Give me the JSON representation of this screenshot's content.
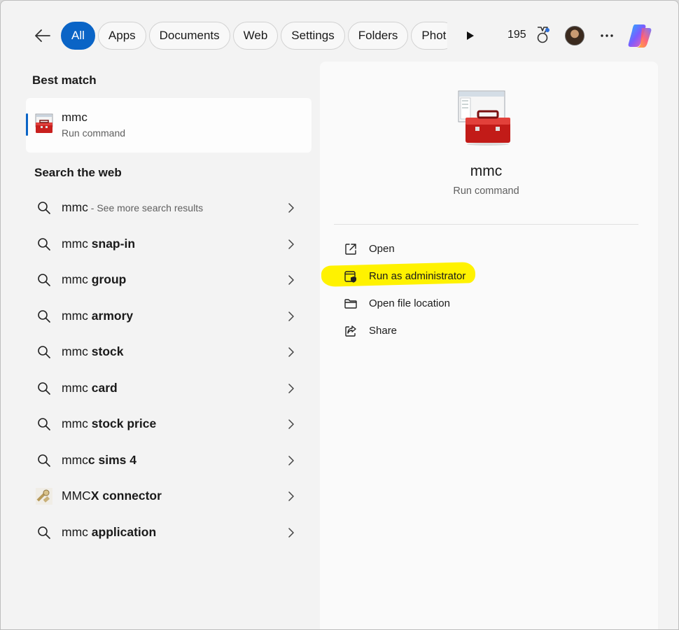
{
  "toolbar": {
    "filters": [
      "All",
      "Apps",
      "Documents",
      "Web",
      "Settings",
      "Folders",
      "Phot"
    ],
    "active_filter": "All",
    "points": "195"
  },
  "best_match": {
    "heading": "Best match",
    "name": "mmc",
    "type": "Run command"
  },
  "web_search": {
    "heading": "Search the web",
    "items": [
      {
        "prefix": "mmc",
        "bold": "",
        "more": " - See more search results",
        "icon": "search-icon"
      },
      {
        "prefix": "mmc ",
        "bold": "snap-in",
        "more": "",
        "icon": "search-icon"
      },
      {
        "prefix": "mmc ",
        "bold": "group",
        "more": "",
        "icon": "search-icon"
      },
      {
        "prefix": "mmc ",
        "bold": "armory",
        "more": "",
        "icon": "search-icon"
      },
      {
        "prefix": "mmc ",
        "bold": "stock",
        "more": "",
        "icon": "search-icon"
      },
      {
        "prefix": "mmc ",
        "bold": "card",
        "more": "",
        "icon": "search-icon"
      },
      {
        "prefix": "mmc ",
        "bold": "stock price",
        "more": "",
        "icon": "search-icon"
      },
      {
        "prefix": "mmc",
        "bold": "c sims 4",
        "more": "",
        "icon": "search-icon"
      },
      {
        "prefix": "MMC",
        "bold": "X connector",
        "more": "",
        "icon": "connector-thumbnail"
      },
      {
        "prefix": "mmc ",
        "bold": "application",
        "more": "",
        "icon": "search-icon"
      }
    ]
  },
  "detail": {
    "title": "mmc",
    "subtitle": "Run command",
    "actions": [
      {
        "label": "Open",
        "icon": "open-external-icon"
      },
      {
        "label": "Run as administrator",
        "icon": "shield-admin-icon"
      },
      {
        "label": "Open file location",
        "icon": "folder-icon"
      },
      {
        "label": "Share",
        "icon": "share-icon"
      }
    ]
  },
  "colors": {
    "accent": "#0a64c6",
    "highlight": "#fff200"
  }
}
